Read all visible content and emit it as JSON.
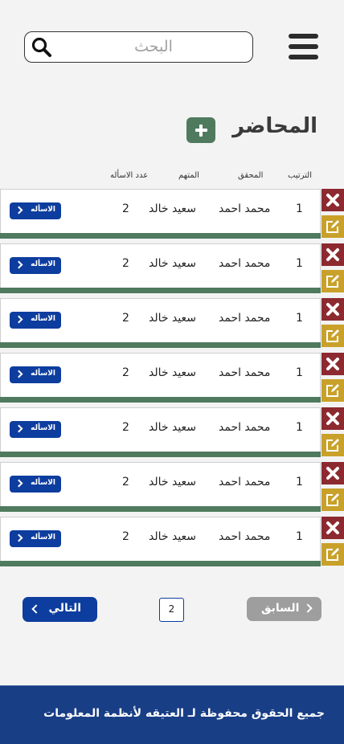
{
  "header": {
    "search_placeholder": "البحث"
  },
  "page": {
    "title": "المحاضر"
  },
  "table": {
    "columns": {
      "rank": "الترتيب",
      "investigator": "المحقق",
      "accused": "المتهم",
      "question_count": "عدد الاسأله"
    },
    "rows": [
      {
        "rank": "1",
        "investigator": "محمد احمد",
        "accused": "سعيد خالد",
        "question_count": "2",
        "questions_label": "الاسأله"
      },
      {
        "rank": "1",
        "investigator": "محمد احمد",
        "accused": "سعيد خالد",
        "question_count": "2",
        "questions_label": "الاسأله"
      },
      {
        "rank": "1",
        "investigator": "محمد احمد",
        "accused": "سعيد خالد",
        "question_count": "2",
        "questions_label": "الاسأله"
      },
      {
        "rank": "1",
        "investigator": "محمد احمد",
        "accused": "سعيد خالد",
        "question_count": "2",
        "questions_label": "الاسأله"
      },
      {
        "rank": "1",
        "investigator": "محمد احمد",
        "accused": "سعيد خالد",
        "question_count": "2",
        "questions_label": "الاسأله"
      },
      {
        "rank": "1",
        "investigator": "محمد احمد",
        "accused": "سعيد خالد",
        "question_count": "2",
        "questions_label": "الاسأله"
      },
      {
        "rank": "1",
        "investigator": "محمد احمد",
        "accused": "سعيد خالد",
        "question_count": "2",
        "questions_label": "الاسأله"
      }
    ]
  },
  "pagination": {
    "prev_label": "السابق",
    "current_page": "2",
    "next_label": "التالي"
  },
  "footer": {
    "text": "جميع الحقوق محفوظة لـ العتيقه لأنظمة المعلومات"
  },
  "colors": {
    "primary_blue": "#0d3d9e",
    "green_accent": "#4f7a5e",
    "delete_red": "#8c2a30",
    "edit_gold": "#c9a12a",
    "footer_blue": "#183e86",
    "disabled_gray": "#9e9e9e"
  },
  "icons": {
    "menu": "hamburger-icon",
    "search": "search-icon",
    "add": "plus-icon",
    "delete": "close-x-icon",
    "edit": "edit-pencil-icon",
    "next": "chevron-left-icon",
    "prev": "chevron-right-icon"
  }
}
